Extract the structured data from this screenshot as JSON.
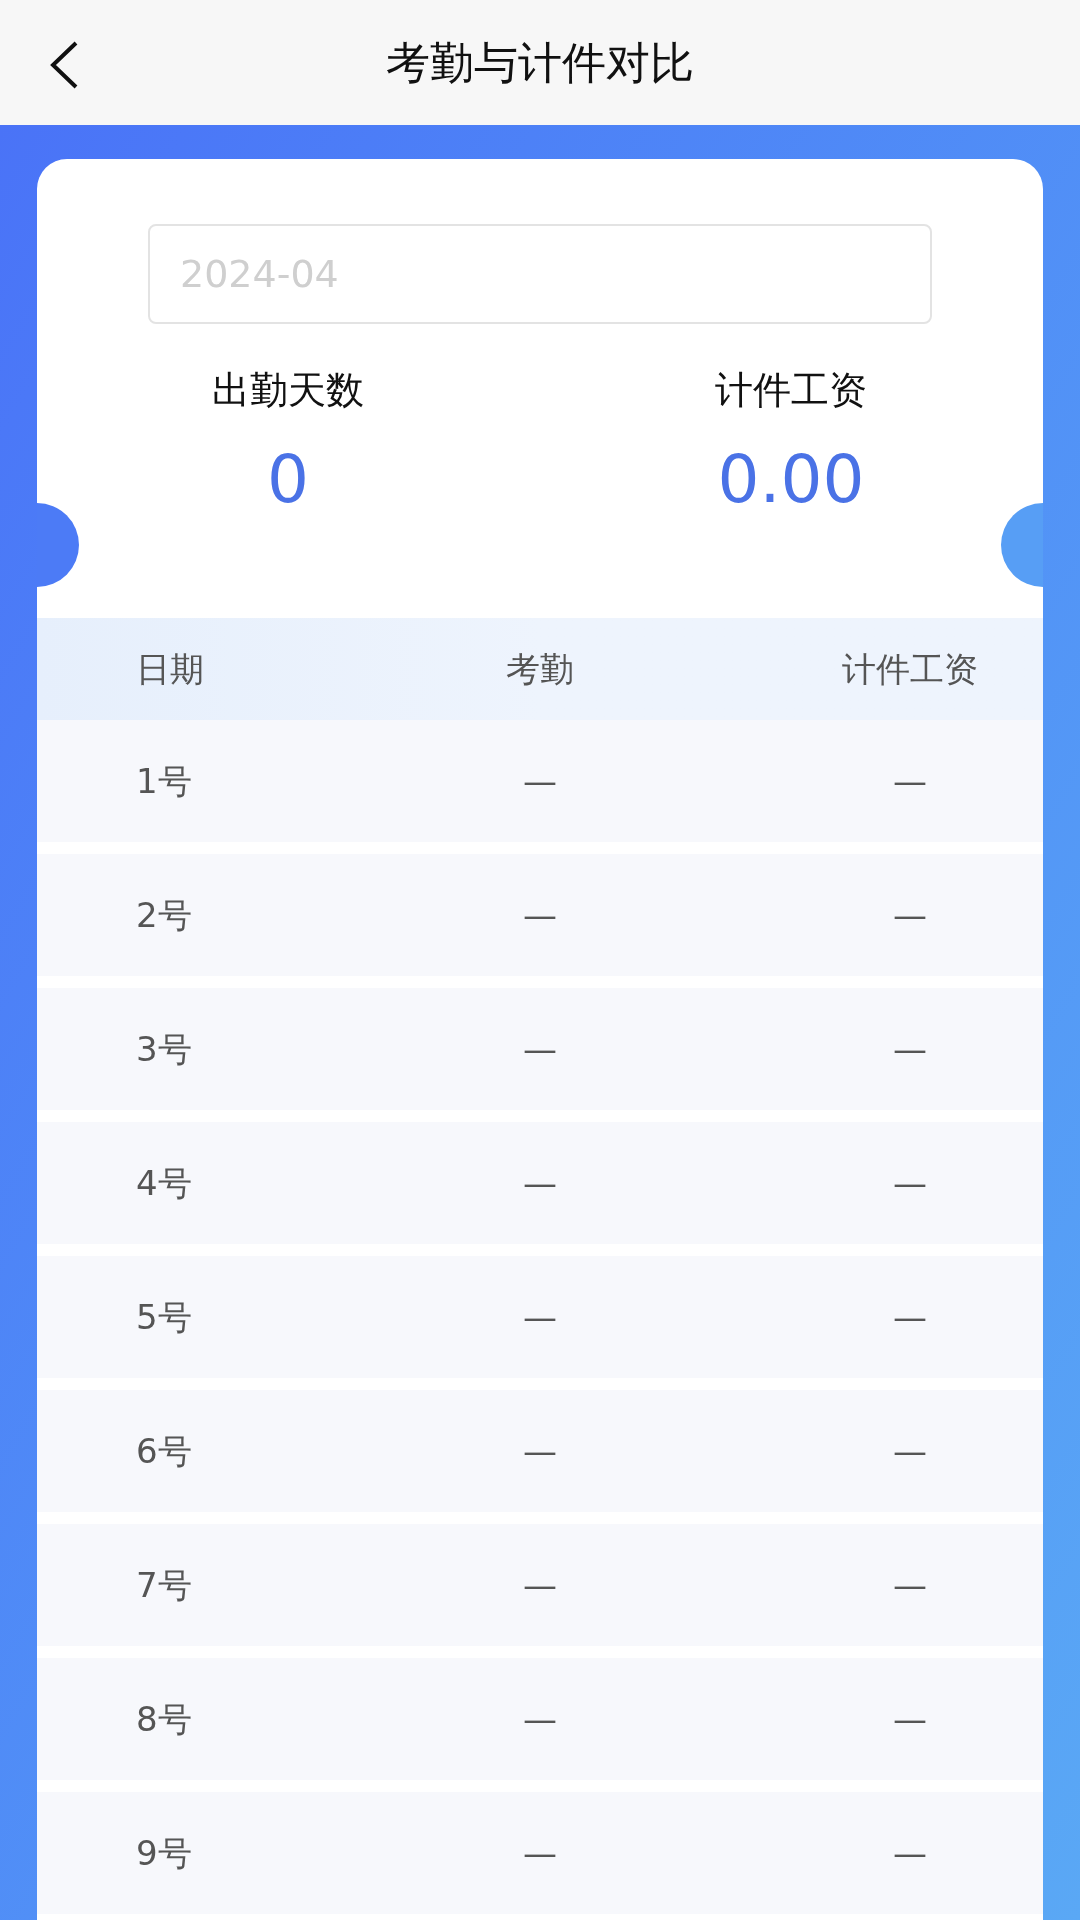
{
  "header": {
    "title": "考勤与计件对比"
  },
  "month_field": {
    "placeholder": "2024-04"
  },
  "stats": [
    {
      "label": "出勤天数",
      "value": "0"
    },
    {
      "label": "计件工资",
      "value": "0.00"
    }
  ],
  "table": {
    "columns": [
      "日期",
      "考勤",
      "计件工资"
    ],
    "rows": [
      [
        "1号",
        "—",
        "—"
      ],
      [
        "2号",
        "—",
        "—"
      ],
      [
        "3号",
        "—",
        "—"
      ],
      [
        "4号",
        "—",
        "—"
      ],
      [
        "5号",
        "—",
        "—"
      ],
      [
        "6号",
        "—",
        "—"
      ],
      [
        "7号",
        "—",
        "—"
      ],
      [
        "8号",
        "—",
        "—"
      ],
      [
        "9号",
        "—",
        "—"
      ]
    ]
  }
}
